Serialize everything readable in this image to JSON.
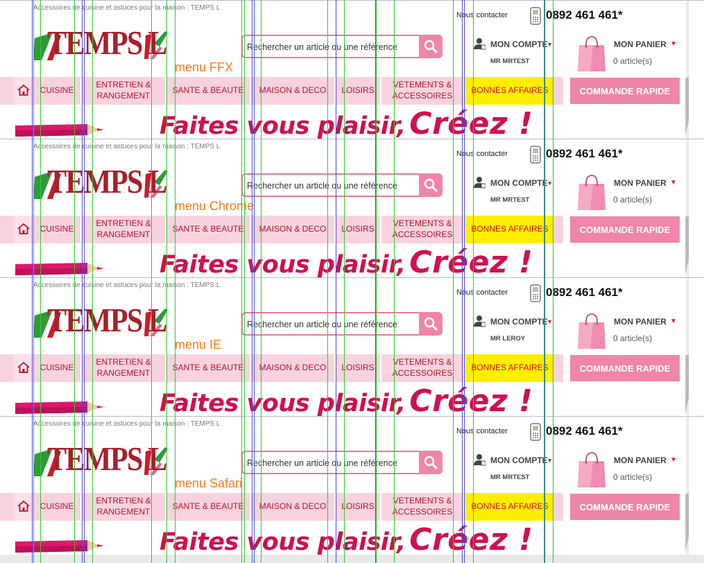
{
  "panels": [
    {
      "browser_label": "menu FFX",
      "user_name": "MR MRTEST",
      "breadcrumb": "Accessoires de cuisine et astuces pour la maison : TEMPS L",
      "contact": "Nous contacter",
      "phone": "0892 461 461*",
      "search_placeholder": "Rechercher un article ou une référence",
      "account_label": "MON COMPTE",
      "cart_label": "MON PANIER",
      "cart_count": "0 article(s)",
      "logo_text": "TEMPS L",
      "menu": [
        {
          "label": "CUISINE"
        },
        {
          "label": "ENTRETIEN &\nRANGEMENT"
        },
        {
          "label": "SANTE & BEAUTE"
        },
        {
          "label": "MAISON & DECO"
        },
        {
          "label": "LOISIRS"
        },
        {
          "label": "VETEMENTS &\nACCESSOIRES"
        },
        {
          "label": "BONNES AFFAIRES"
        }
      ],
      "quick_order": "COMMANDE RAPIDE",
      "banner_lead": "Faites vous plaisir,",
      "banner_accent": "Créez !"
    },
    {
      "browser_label": "menu Chrome",
      "user_name": "MR MRTEST",
      "breadcrumb": "Accessoires de cuisine et astuces pour la maison : TEMPS L",
      "contact": "Nous contacter",
      "phone": "0892 461 461*",
      "search_placeholder": "Rechercher un article ou une référence",
      "account_label": "MON COMPTE",
      "cart_label": "MON PANIER",
      "cart_count": "0 article(s)",
      "logo_text": "TEMPS L",
      "menu": [
        {
          "label": "CUISINE"
        },
        {
          "label": "ENTRETIEN &\nRANGEMENT"
        },
        {
          "label": "SANTE & BEAUTE"
        },
        {
          "label": "MAISON & DECO"
        },
        {
          "label": "LOISIRS"
        },
        {
          "label": "VETEMENTS &\nACCESSOIRES"
        },
        {
          "label": "BONNES AFFAIRES"
        }
      ],
      "quick_order": "COMMANDE RAPIDE",
      "banner_lead": "Faites vous plaisir,",
      "banner_accent": "Créez !"
    },
    {
      "browser_label": "menu IE",
      "user_name": "MR LEROY",
      "breadcrumb": "Accessoires de cuisine et astuces pour la maison : TEMPS L",
      "contact": "Nous contacter",
      "phone": "0892 461 461*",
      "search_placeholder": "Rechercher un article ou une référence",
      "account_label": "MON COMPTE",
      "cart_label": "MON PANIER",
      "cart_count": "0 article(s)",
      "logo_text": "TEMPS L",
      "menu": [
        {
          "label": "CUISINE"
        },
        {
          "label": "ENTRETIEN &\nRANGEMENT"
        },
        {
          "label": "SANTE & BEAUTE"
        },
        {
          "label": "MAISON & DECO"
        },
        {
          "label": "LOISIRS"
        },
        {
          "label": "VETEMENTS &\nACCESSOIRES"
        },
        {
          "label": "BONNES AFFAIRES"
        }
      ],
      "quick_order": "COMMANDE RAPIDE",
      "banner_lead": "Faites vous plaisir,",
      "banner_accent": "Créez !"
    },
    {
      "browser_label": "menu Safari",
      "user_name": "MR MRTEST",
      "breadcrumb": "Accessoires de cuisine et astuces pour la maison : TEMPS L",
      "contact": "Nous contacter",
      "phone": "0892 461 461*",
      "search_placeholder": "Rechercher un article ou une référence",
      "account_label": "MON COMPTE",
      "cart_label": "MON PANIER",
      "cart_count": "0 article(s)",
      "logo_text": "TEMPS L",
      "menu": [
        {
          "label": "CUISINE"
        },
        {
          "label": "ENTRETIEN &\nRANGEMENT"
        },
        {
          "label": "SANTE & BEAUTE"
        },
        {
          "label": "MAISON & DECO"
        },
        {
          "label": "LOISIRS"
        },
        {
          "label": "VETEMENTS &\nACCESSOIRES"
        },
        {
          "label": "BONNES AFFAIRES"
        }
      ],
      "quick_order": "COMMANDE RAPIDE",
      "banner_lead": "Faites vous plaisir,",
      "banner_accent": "Créez !"
    }
  ],
  "colors": {
    "brand_pink": "#ef86a8",
    "menu_pink": "#f8d3df",
    "menu_text": "#b2132a",
    "promo_yellow": "#ffee00",
    "banner_magenta": "#d0104f",
    "label_orange": "#ff7a1a",
    "guide_green": "#2ec82e",
    "guide_blue": "#4a4ad8"
  },
  "icons": [
    "home-icon",
    "search-icon",
    "phone-icon",
    "user-icon",
    "shopping-bag-icon",
    "pencil-icon"
  ]
}
